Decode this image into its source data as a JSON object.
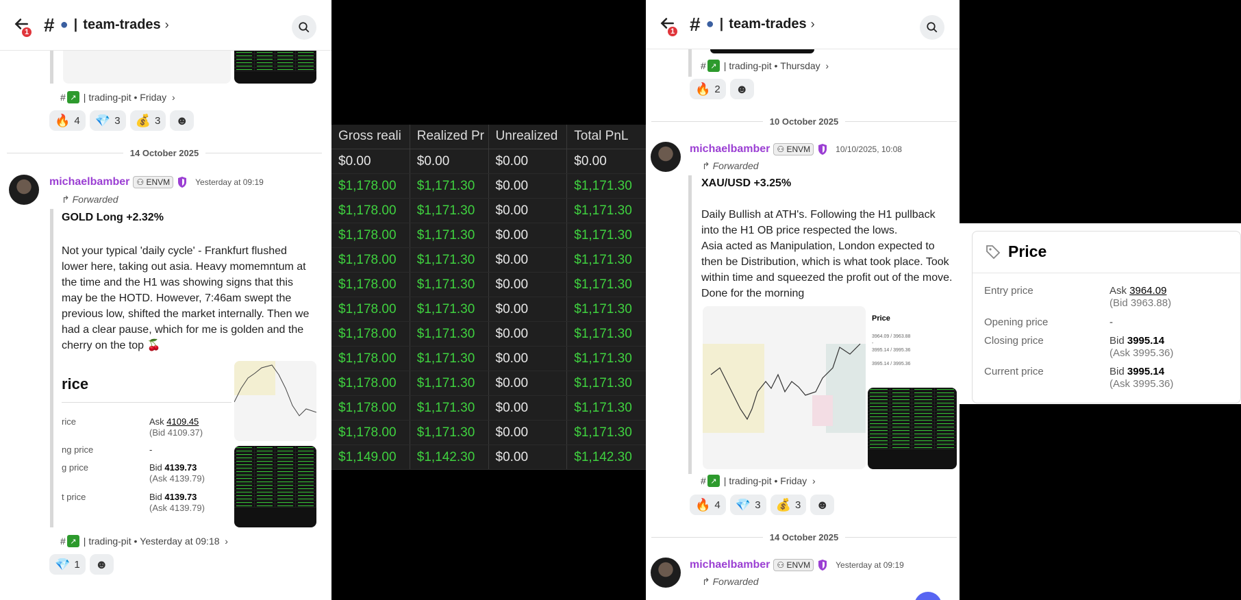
{
  "channel": {
    "name": "team-trades",
    "notification_count": "1"
  },
  "panel1": {
    "ref_top": {
      "channel": "trading-pit",
      "when": "Friday"
    },
    "reactions_top": [
      {
        "emoji": "🔥",
        "count": "4"
      },
      {
        "emoji": "💎",
        "count": "3"
      },
      {
        "emoji": "💰",
        "count": "3"
      }
    ],
    "date_divider": "14 October 2025",
    "message": {
      "username": "michaelbamber",
      "tag": "ENVM",
      "timestamp": "Yesterday at 09:19",
      "forwarded": "Forwarded",
      "title": "GOLD Long +2.32%",
      "body": "Not your typical 'daily cycle' - Frankfurt flushed lower here, taking out asia. Heavy momemntum at the time and the H1 was showing signs that this may be the HOTD. However, 7:46am swept the previous low, shifted the market internally. Then we had a clear pause, which for me is golden and the cherry on the top 🍒"
    },
    "price_card": {
      "heading": "rice",
      "rows": [
        {
          "label": "rice",
          "kind": "Ask",
          "value": "4109.45",
          "sub": "(Bid 4109.37)"
        },
        {
          "label": "ng price",
          "kind": "",
          "value": "-",
          "sub": ""
        },
        {
          "label": "g price",
          "kind": "Bid",
          "value": "4139.73",
          "sub": "(Ask 4139.79)"
        },
        {
          "label": "t price",
          "kind": "Bid",
          "value": "4139.73",
          "sub": "(Ask 4139.79)"
        }
      ]
    },
    "ref_bottom": {
      "channel": "trading-pit",
      "when": "Yesterday at 09:18"
    },
    "reactions_bottom": [
      {
        "emoji": "💎",
        "count": "1"
      }
    ]
  },
  "table": {
    "headers": [
      "Gross reali",
      "Realized Pr",
      "Unrealized",
      "Total PnL"
    ],
    "rows": [
      [
        "$0.00",
        "$0.00",
        "$0.00",
        "$0.00"
      ],
      [
        "$1,178.00",
        "$1,171.30",
        "$0.00",
        "$1,171.30"
      ],
      [
        "$1,178.00",
        "$1,171.30",
        "$0.00",
        "$1,171.30"
      ],
      [
        "$1,178.00",
        "$1,171.30",
        "$0.00",
        "$1,171.30"
      ],
      [
        "$1,178.00",
        "$1,171.30",
        "$0.00",
        "$1,171.30"
      ],
      [
        "$1,178.00",
        "$1,171.30",
        "$0.00",
        "$1,171.30"
      ],
      [
        "$1,178.00",
        "$1,171.30",
        "$0.00",
        "$1,171.30"
      ],
      [
        "$1,178.00",
        "$1,171.30",
        "$0.00",
        "$1,171.30"
      ],
      [
        "$1,178.00",
        "$1,171.30",
        "$0.00",
        "$1,171.30"
      ],
      [
        "$1,178.00",
        "$1,171.30",
        "$0.00",
        "$1,171.30"
      ],
      [
        "$1,178.00",
        "$1,171.30",
        "$0.00",
        "$1,171.30"
      ],
      [
        "$1,178.00",
        "$1,171.30",
        "$0.00",
        "$1,171.30"
      ],
      [
        "$1,149.00",
        "$1,142.30",
        "$0.00",
        "$1,142.30"
      ]
    ],
    "colors": {
      "positive": "#3fd13f",
      "zero": "#e8e8e8"
    }
  },
  "panel3": {
    "ref_top": {
      "channel": "trading-pit",
      "when": "Thursday"
    },
    "reactions_top": [
      {
        "emoji": "🔥",
        "count": "2"
      }
    ],
    "date_divider_1": "10 October 2025",
    "message": {
      "username": "michaelbamber",
      "tag": "ENVM",
      "timestamp": "10/10/2025, 10:08",
      "forwarded": "Forwarded",
      "title": "XAU/USD +3.25%",
      "body": "Daily Bullish at ATH's. Following the H1 pullback into the H1 OB price respected the lows.\nAsia acted as Manipulation, London expected to then be Distribution, which is what took place. Took within time and squeezed the profit out of the move. Done for the morning"
    },
    "ref_mid": {
      "channel": "trading-pit",
      "when": "Friday"
    },
    "reactions_mid": [
      {
        "emoji": "🔥",
        "count": "4"
      },
      {
        "emoji": "💎",
        "count": "3"
      },
      {
        "emoji": "💰",
        "count": "3"
      }
    ],
    "date_divider_2": "14 October 2025",
    "message2": {
      "username": "michaelbamber",
      "tag": "ENVM",
      "timestamp": "Yesterday at 09:19",
      "forwarded": "Forwarded"
    }
  },
  "panel4": {
    "heading": "Price",
    "rows": [
      {
        "label": "Entry price",
        "kind": "Ask",
        "value": "3964.09",
        "sub": "(Bid 3963.88)"
      },
      {
        "label": "Opening price",
        "kind": "",
        "value": "-",
        "sub": ""
      },
      {
        "label": "Closing price",
        "kind": "Bid",
        "value": "3995.14",
        "sub": "(Ask 3995.36)"
      },
      {
        "label": "Current price",
        "kind": "Bid",
        "value": "3995.14",
        "sub": "(Ask 3995.36)"
      }
    ]
  }
}
